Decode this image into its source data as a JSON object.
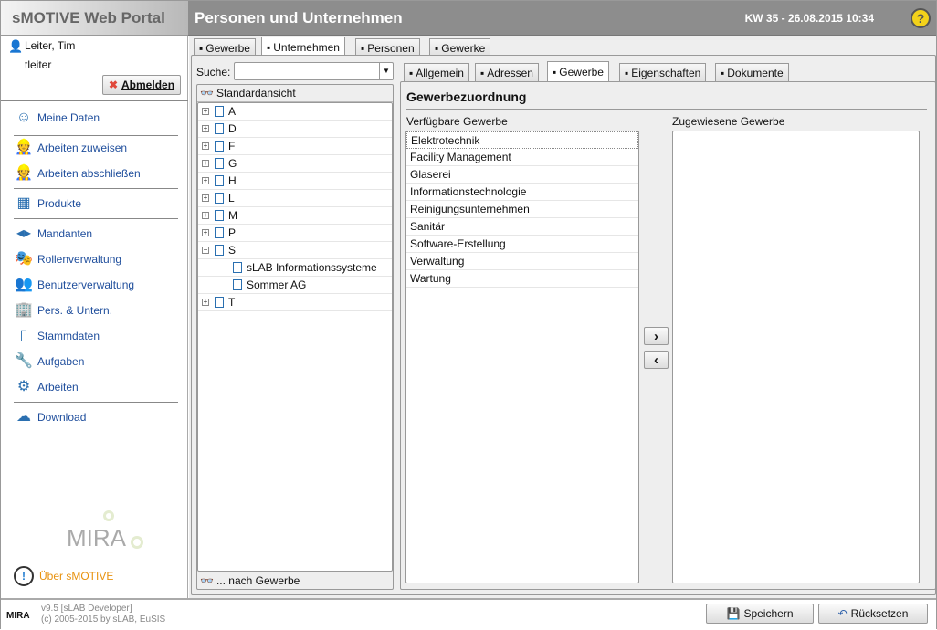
{
  "header": {
    "app_title": "sMOTIVE Web Portal",
    "page_title": "Personen und Unternehmen",
    "datetime": "KW 35 - 26.08.2015 10:34",
    "help_icon": "question-icon"
  },
  "user": {
    "name": "Leiter, Tim",
    "login": "tleiter",
    "logout": "Abmelden"
  },
  "menu": [
    {
      "label": "Meine Daten",
      "icon": "user-icon"
    },
    {
      "label": "Arbeiten zuweisen",
      "icon": "worker-icon"
    },
    {
      "label": "Arbeiten abschließen",
      "icon": "worker-done-icon"
    },
    {
      "label": "Produkte",
      "icon": "product-icon"
    },
    {
      "label": "Mandanten",
      "icon": "client-icon"
    },
    {
      "label": "Rollenverwaltung",
      "icon": "masks-icon"
    },
    {
      "label": "Benutzerverwaltung",
      "icon": "users-icon"
    },
    {
      "label": "Pers. & Untern.",
      "icon": "building-icon"
    },
    {
      "label": "Stammdaten",
      "icon": "tablet-icon"
    },
    {
      "label": "Aufgaben",
      "icon": "wrench-icon"
    },
    {
      "label": "Arbeiten",
      "icon": "gear-icon"
    },
    {
      "label": "Download",
      "icon": "cloud-download-icon"
    }
  ],
  "about": "Über sMOTIVE",
  "logo": "MIRA",
  "top_tabs": [
    "Gewerbe",
    "Unternehmen",
    "Personen",
    "Gewerke"
  ],
  "search": {
    "label": "Suche:",
    "value": ""
  },
  "tree": {
    "header": "Standardansicht",
    "footer": "... nach Gewerbe",
    "nodes": [
      "A",
      "D",
      "F",
      "G",
      "H",
      "L",
      "M",
      "P",
      "S",
      "sLAB Informationssysteme",
      "Sommer AG",
      "T"
    ]
  },
  "detail_tabs": [
    "Allgemein",
    "Adressen",
    "Gewerbe",
    "Eigenschaften",
    "Dokumente"
  ],
  "section_title": "Gewerbezuordnung",
  "available": {
    "label": "Verfügbare Gewerbe",
    "items": [
      "Elektrotechnik",
      "Facility Management",
      "Glaserei",
      "Informationstechnologie",
      "Reinigungsunternehmen",
      "Sanitär",
      "Software-Erstellung",
      "Verwaltung",
      "Wartung"
    ]
  },
  "assigned": {
    "label": "Zugewiesene Gewerbe",
    "items": []
  },
  "move": {
    "add": "›",
    "remove": "‹"
  },
  "footer": {
    "version": "v9.5 [sLAB Developer]",
    "copyright": "(c) 2005-2015 by sLAB, EuSIS",
    "save": "Speichern",
    "reset": "Rücksetzen"
  }
}
